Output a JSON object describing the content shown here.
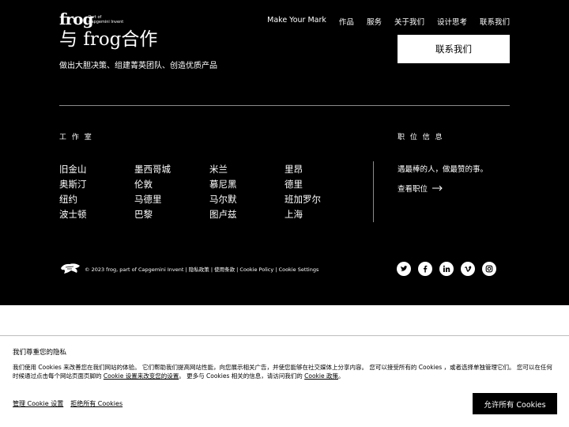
{
  "header": {
    "logo_word": "frog",
    "logo_sub": "Part of\nCapgemini Invent",
    "nav": [
      "Make Your Mark",
      "作品",
      "服务",
      "关于我们",
      "设计思考",
      "联系我们"
    ]
  },
  "hero": {
    "title_a": "与 ",
    "title_b": "frog",
    "title_c": "合作",
    "subtitle": "做出大胆决策、组建菁英团队、创造优质产品",
    "contact_button": "联系我们"
  },
  "studios": {
    "label": "工 作 室",
    "cities": [
      "旧金山",
      "墨西哥城",
      "米兰",
      "里昂",
      "奥斯汀",
      "伦敦",
      "慕尼黑",
      "德里",
      "纽约",
      "马德里",
      "马尔默",
      "班加罗尔",
      "波士顿",
      "巴黎",
      "图卢兹",
      "上海"
    ]
  },
  "careers": {
    "label": "职 位 信 息",
    "text": "遇最棒的人，做最赞的事。",
    "link": "查看职位"
  },
  "footer": {
    "copyright": "© 2023 frog, part of Capgemini Invent",
    "links": [
      "隐私政策",
      "使用条款",
      "Cookie Policy",
      "Cookie Settings"
    ],
    "socials": [
      "twitter-icon",
      "facebook-icon",
      "linkedin-icon",
      "vimeo-icon",
      "instagram-icon"
    ]
  },
  "cookie": {
    "title": "我们尊重您的隐私",
    "text_a": "我们使用 Cookies 来改善您在我们网站的体验。 它们帮助我们提高网站性能，向您展示相关广告，并使您能够在社交媒体上分享内容。 您可以接受所有的 Cookies ，或者选择单独管理它们。 您可以在任何时候通过点击每个网站页面页脚的 ",
    "link_a": "Cookie 设置来改变您的设置",
    "text_b": "。 更多与 Cookies 相关的信息，请访问我们的 ",
    "link_b": "Cookie 政策",
    "text_c": "。",
    "manage": "管理 Cookie 设置",
    "reject": "拒绝所有 Cookies",
    "allow": "允许所有 Cookies"
  },
  "colors": {
    "dark_bg": "#000000",
    "light_bg": "#ffffff"
  }
}
